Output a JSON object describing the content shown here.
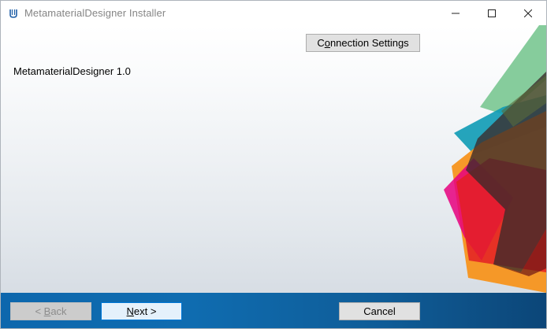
{
  "window": {
    "title": "MetamaterialDesigner Installer",
    "app_icon": "installer-app-icon",
    "controls": {
      "minimize_icon": "minimize-icon",
      "maximize_icon": "maximize-icon",
      "close_icon": "close-icon"
    }
  },
  "main": {
    "product_name": "MetamaterialDesigner 1.0",
    "connection_settings": {
      "accel": "o",
      "before": "C",
      "after": "nnection Settings"
    }
  },
  "footer": {
    "back": {
      "prefix": "< ",
      "accel": "B",
      "after": "ack",
      "enabled": false
    },
    "next": {
      "accel": "N",
      "after": "ext >"
    },
    "cancel": {
      "label": "Cancel"
    }
  },
  "colors": {
    "footer_blue": "#0f6cb0",
    "art_green": "#7cc894",
    "art_teal": "#0e9bb5",
    "art_orange": "#f7941d",
    "art_red": "#e31e24",
    "art_magenta": "#e6007e",
    "art_dark": "#3a2a2a"
  }
}
